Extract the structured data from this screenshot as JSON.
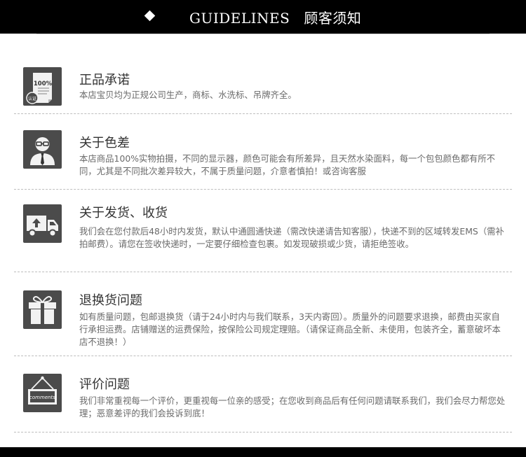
{
  "header": {
    "title_en": "GUIDELINES",
    "title_cn": "顾客须知"
  },
  "sections": [
    {
      "icon": "certificate-icon",
      "icon_text": "100%",
      "icon_stamp": "认证",
      "title": "正品承诺",
      "text": "本店宝贝均为正规公司生产，商标、水洗标、吊牌齐全。"
    },
    {
      "icon": "person-glasses-icon",
      "title": "关于色差",
      "text": "本店商品100%实物拍摄，不同的显示器，颜色可能会有所差异，且天然水染面料，每一个包包颜色都有所不同，尤其是不同批次差异较大，不属于质量问题，介意者慎拍！或咨询客服"
    },
    {
      "icon": "delivery-truck-icon",
      "title": "关于发货、收货",
      "text": "我们会在您付款后48小时内发货，默认中通圆通快递（需改快递请告知客服），快递不到的区域转发EMS（需补拍邮费）。请您在签收快递时，一定要仔细检查包裹。如发现破损或少货，请拒绝签收。"
    },
    {
      "icon": "gift-box-icon",
      "title": "退换货问题",
      "text": "如有质量问题，包邮退换货（请于24小时内与我们联系，3天内寄回）。质量外的问题要求退换，邮费由买家自行承担运费。店铺赠送的运费保险，按保险公司规定理赔。（请保证商品全新、未使用，包装齐全，蓄意破坏本店不退换！）"
    },
    {
      "icon": "comments-sign-icon",
      "icon_text": "comments",
      "title": "评价问题",
      "text": "我们非常重视每一个评价，更重视每一位亲的感受；在您收到商品后有任何问题请联系我们，我们会尽力帮您处理；恶意差评的我们会投诉到底！"
    }
  ]
}
